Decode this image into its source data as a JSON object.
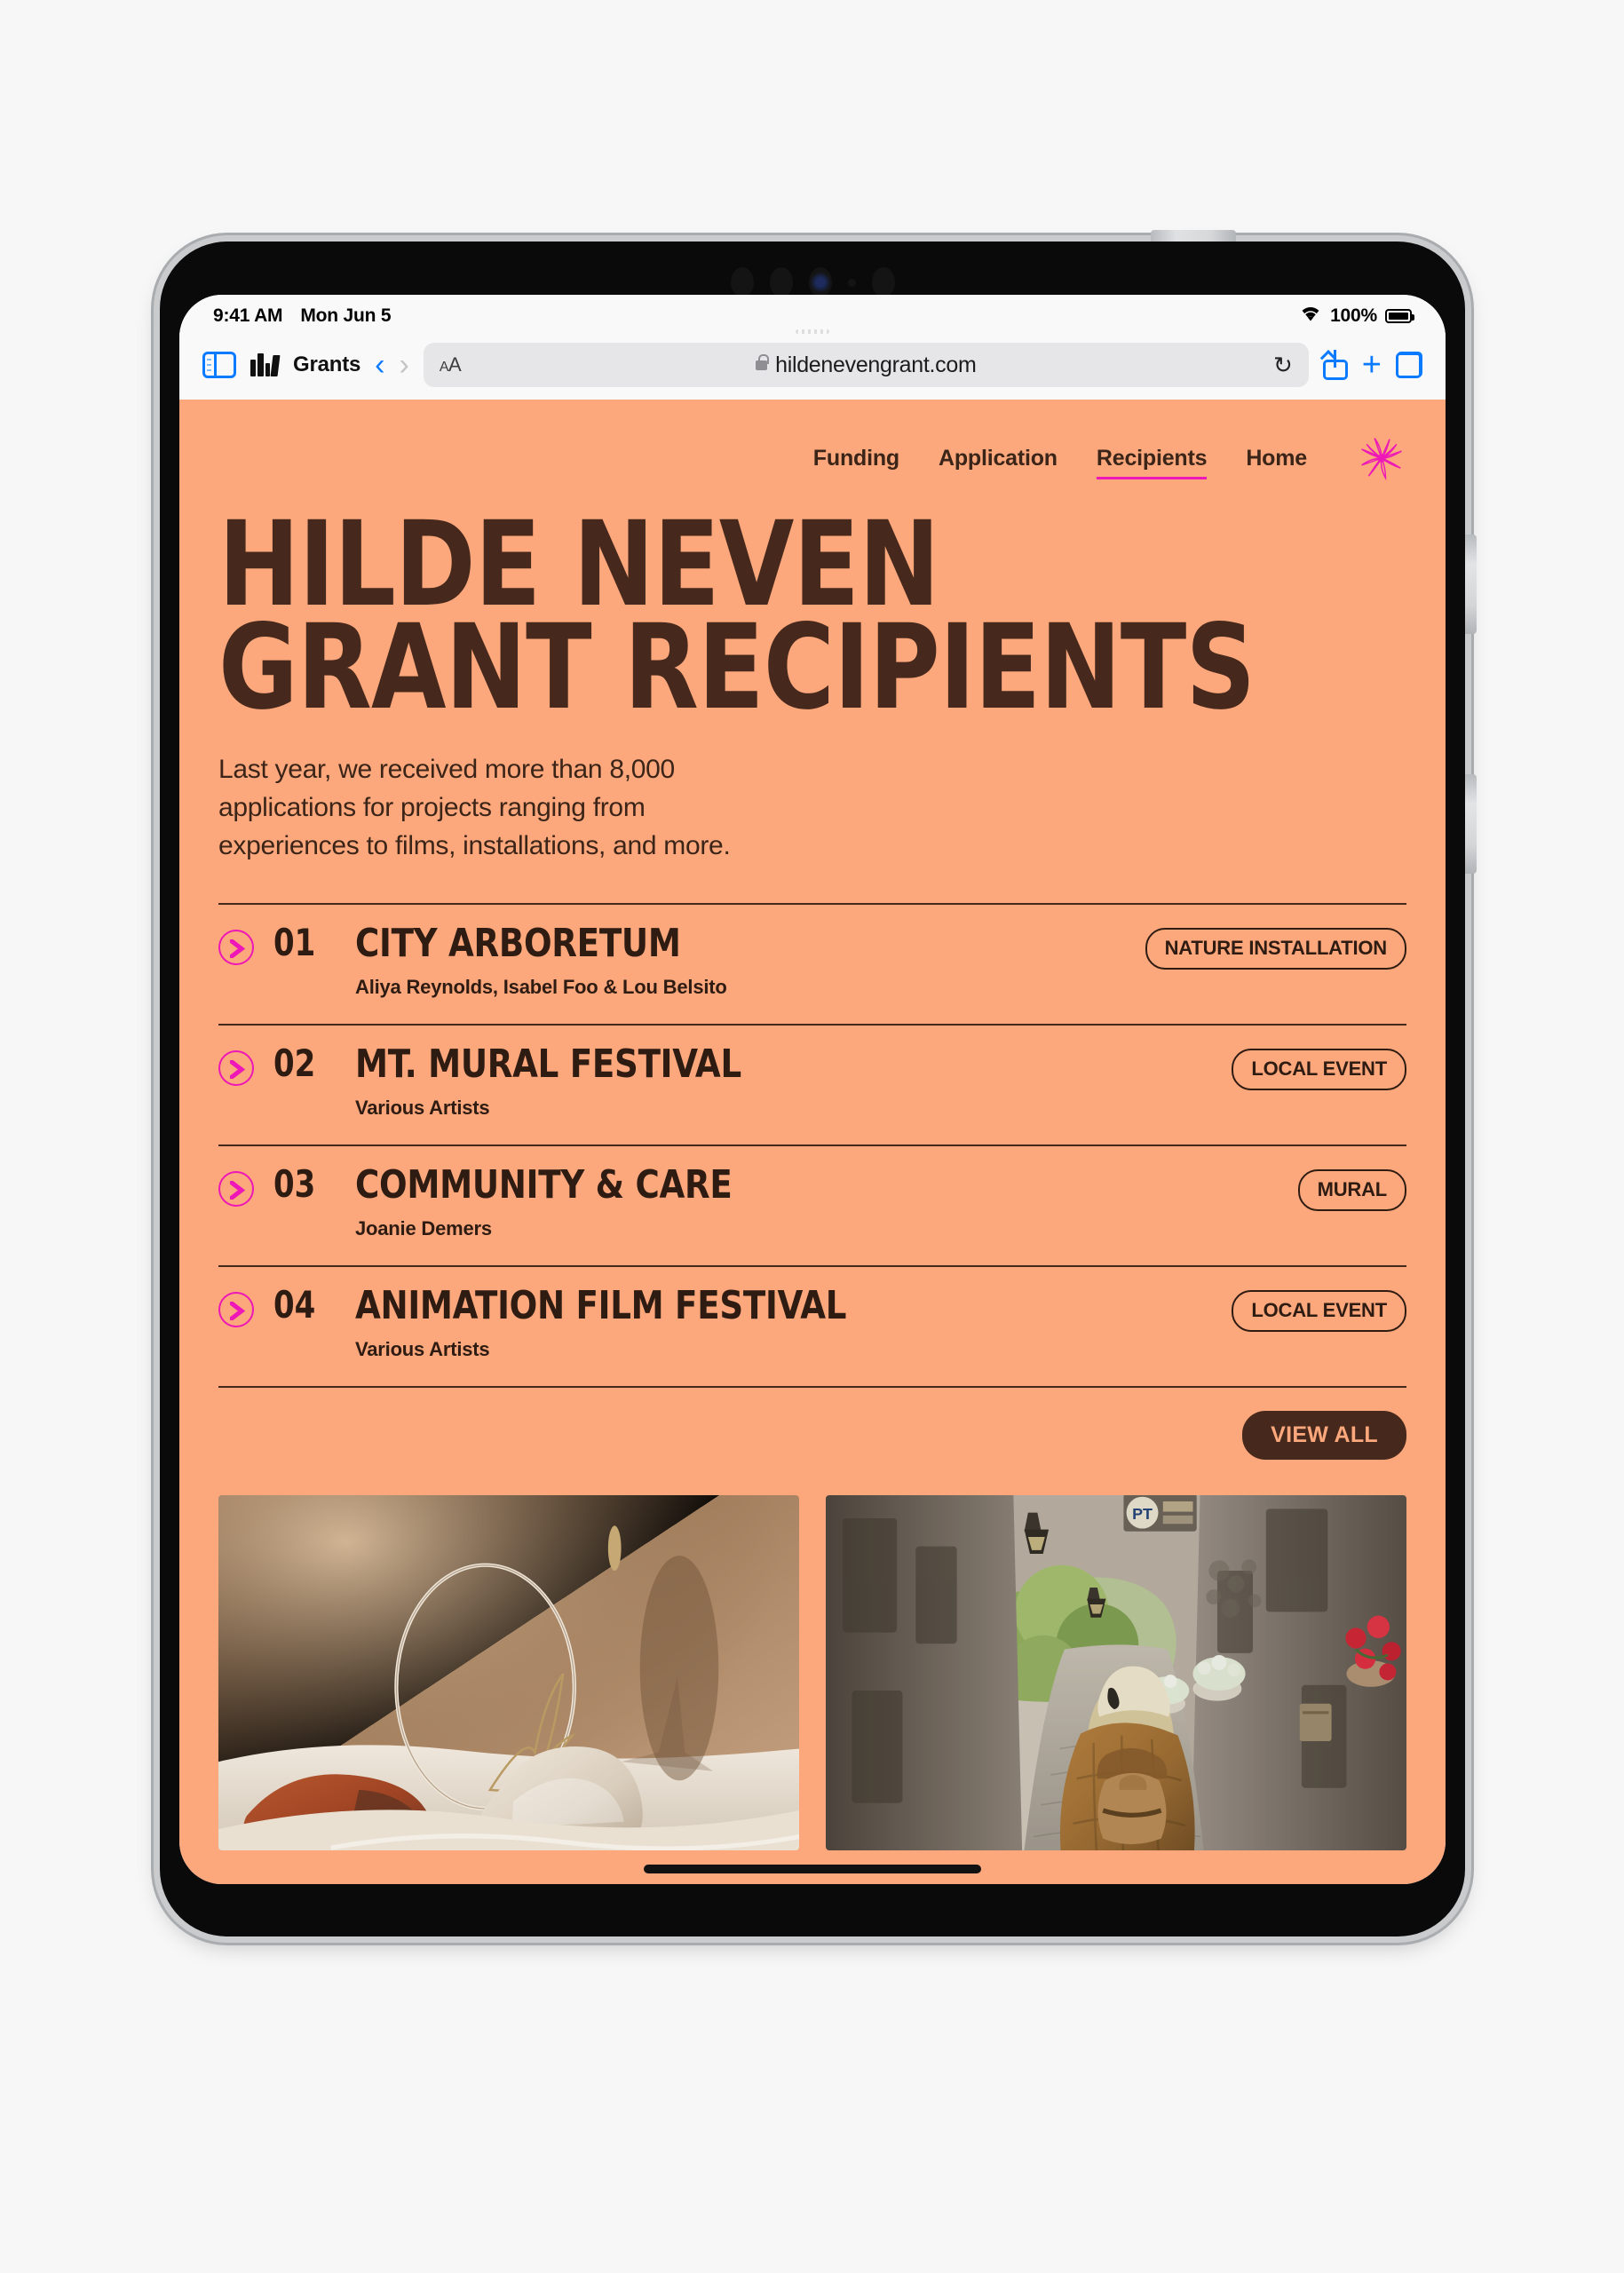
{
  "status_bar": {
    "time": "9:41 AM",
    "date": "Mon Jun 5",
    "battery_percent": "100%",
    "wifi_icon": "wifi-icon",
    "battery_icon": "battery-full-icon"
  },
  "browser": {
    "sidebar_icon": "sidebar-icon",
    "bookmarks_icon": "books-icon",
    "tab_title": "Grants",
    "back_icon": "chevron-left-icon",
    "forward_icon": "chevron-right-icon",
    "text_size_label": "AA",
    "lock_icon": "lock-icon",
    "url": "hildenevengrant.com",
    "reload_icon": "reload-icon",
    "share_icon": "share-icon",
    "new_tab_icon": "plus-icon",
    "tabs_icon": "tabs-overview-icon"
  },
  "site": {
    "nav": [
      {
        "label": "Funding",
        "active": false
      },
      {
        "label": "Application",
        "active": false
      },
      {
        "label": "Recipients",
        "active": true
      },
      {
        "label": "Home",
        "active": false
      }
    ],
    "logo_icon": "starburst-flower-icon",
    "headline": "HILDE NEVEN\nGRANT RECIPIENTS",
    "lede": "Last year, we received more than 8,000\napplications for projects ranging from\nexperiences to films, installations, and more.",
    "recipients": [
      {
        "number": "01",
        "title": "CITY ARBORETUM",
        "artists": "Aliya Reynolds, Isabel Foo & Lou Belsito",
        "tag": "NATURE INSTALLATION"
      },
      {
        "number": "02",
        "title": "MT. MURAL FESTIVAL",
        "artists": "Various Artists",
        "tag": "LOCAL EVENT"
      },
      {
        "number": "03",
        "title": "COMMUNITY & CARE",
        "artists": "Joanie Demers",
        "tag": "MURAL"
      },
      {
        "number": "04",
        "title": "ANIMATION FILM FESTIVAL",
        "artists": "Various Artists",
        "tag": "LOCAL EVENT"
      }
    ],
    "view_all_label": "VIEW ALL",
    "gallery": [
      {
        "name": "still-life-brick-chalk-ring-photo"
      },
      {
        "name": "woman-walking-stone-alley-photo"
      }
    ]
  },
  "colors": {
    "page_background": "#fca87c",
    "heading_brown": "#46291c",
    "text_brown": "#2e1b12",
    "accent_magenta": "#ee17b7",
    "ios_blue": "#0a7bff"
  }
}
